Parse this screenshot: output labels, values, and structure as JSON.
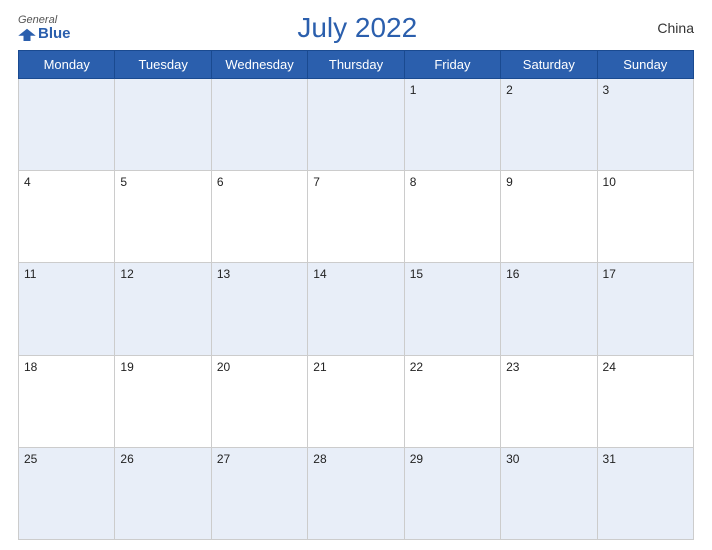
{
  "header": {
    "logo_general": "General",
    "logo_blue": "Blue",
    "title": "July 2022",
    "country": "China"
  },
  "weekdays": [
    "Monday",
    "Tuesday",
    "Wednesday",
    "Thursday",
    "Friday",
    "Saturday",
    "Sunday"
  ],
  "weeks": [
    [
      null,
      null,
      null,
      null,
      1,
      2,
      3
    ],
    [
      4,
      5,
      6,
      7,
      8,
      9,
      10
    ],
    [
      11,
      12,
      13,
      14,
      15,
      16,
      17
    ],
    [
      18,
      19,
      20,
      21,
      22,
      23,
      24
    ],
    [
      25,
      26,
      27,
      28,
      29,
      30,
      31
    ]
  ]
}
